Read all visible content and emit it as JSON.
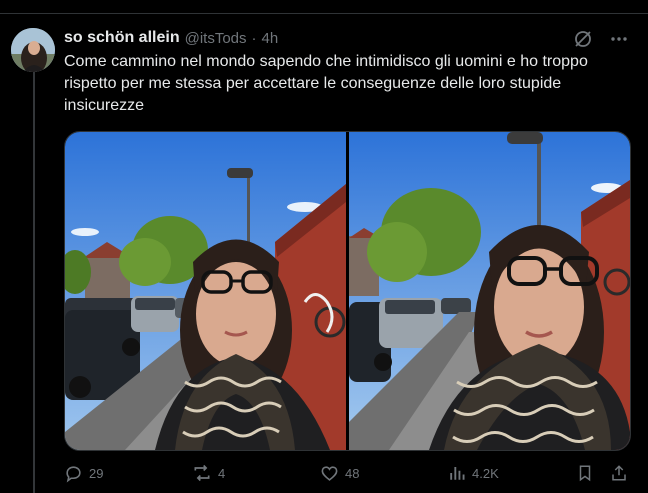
{
  "tweet": {
    "display_name": "so schön allein",
    "handle": "@itsTods",
    "separator": "·",
    "time": "4h",
    "text": "Come cammino nel mondo sapendo che intimidisco gli uomini e ho troppo rispetto per me stessa per accettare le conseguenze delle loro stupide insicurezze",
    "media_count": 2,
    "grok_icon": "grok-icon",
    "more_icon": "more-icon"
  },
  "actions": {
    "reply_count": "29",
    "retweet_count": "4",
    "like_count": "48",
    "views_count": "4.2K",
    "icons": [
      "reply-icon",
      "retweet-icon",
      "like-icon",
      "views-icon",
      "bookmark-icon",
      "share-icon"
    ]
  },
  "colors": {
    "background": "#000000",
    "text_primary": "#e7e9ea",
    "text_secondary": "#71767b",
    "border": "#2f3336"
  }
}
